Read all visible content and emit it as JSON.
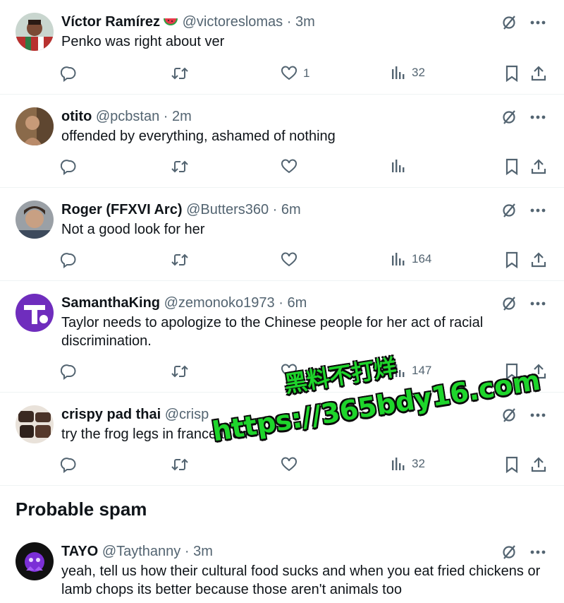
{
  "colors": {
    "text": "#0f1419",
    "muted": "#536471",
    "divider": "#eff3f4",
    "watermark_green": "#1ed52b"
  },
  "icons": [
    "reply-icon",
    "retweet-icon",
    "like-icon",
    "views-icon",
    "bookmark-icon",
    "share-icon",
    "grok-icon",
    "more-icon",
    "watermelon-emoji-icon"
  ],
  "tweets": [
    {
      "name": "Víctor Ramírez",
      "handle": "@victoreslomas",
      "dot": "·",
      "time": "3m",
      "text": "Penko was right about ver",
      "likes": "1",
      "views": "32"
    },
    {
      "name": "otito",
      "handle": "@pcbstan",
      "dot": "·",
      "time": "2m",
      "text": "offended by everything, ashamed of nothing",
      "likes": "",
      "views": ""
    },
    {
      "name": "Roger (FFXVI Arc)",
      "handle": "@Butters360",
      "dot": "·",
      "time": "6m",
      "text": "Not a good look for her",
      "likes": "",
      "views": "164"
    },
    {
      "name": "SamanthaKing",
      "handle": "@zemonoko1973",
      "dot": "·",
      "time": "6m",
      "text": "Taylor needs to apologize to the Chinese people for her act of racial discrimination.",
      "likes": "",
      "views": "147"
    },
    {
      "name": "crispy pad thai",
      "handle": "@crisp",
      "dot": "",
      "time": "",
      "text": "try the frog legs in france then",
      "likes": "",
      "views": "32"
    }
  ],
  "section_title": "Probable spam",
  "spam_tweet": {
    "name": "TAYO",
    "handle": "@Taythanny",
    "dot": "·",
    "time": "3m",
    "text": "yeah, tell us how their cultural food sucks and when you eat fried chickens or lamb chops its better because those aren't animals too"
  },
  "watermark": {
    "line1": "黑料不打烊",
    "line2": "https://365bdy16.com"
  }
}
